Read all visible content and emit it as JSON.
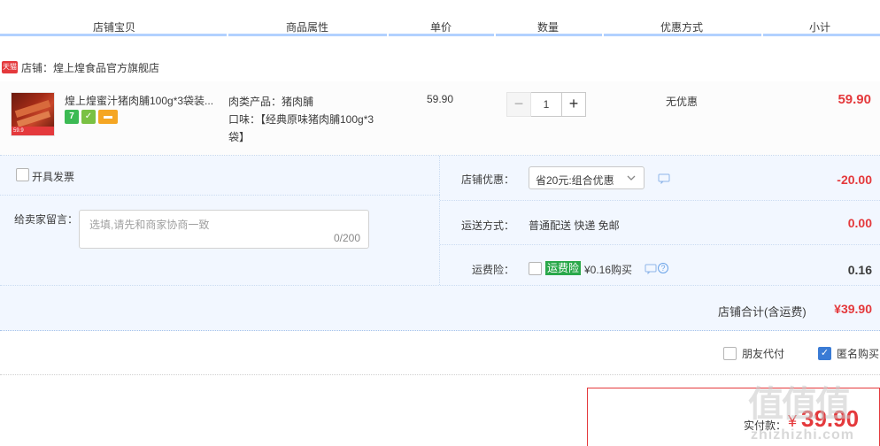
{
  "header": {
    "columns": [
      "店铺宝贝",
      "商品属性",
      "单价",
      "数量",
      "优惠方式",
      "小计"
    ]
  },
  "shop": {
    "badge": "天猫",
    "label": "店铺：煌上煌食品官方旗舰店"
  },
  "item": {
    "thumb_tag": "59.9",
    "title": "煌上煌蜜汁猪肉脯100g*3袋装...",
    "badges": [
      "7",
      "✓",
      "▬"
    ],
    "attr1": "肉类产品：猪肉脯",
    "attr2_line1": "口味：【经典原味猪肉脯100g*3",
    "attr2_line2": "袋】",
    "price": "59.90",
    "quantity": "1",
    "minus": "−",
    "plus": "+",
    "promo": "无优惠",
    "subtotal": "59.90"
  },
  "details": {
    "invoice_label": "开具发票",
    "message_label": "给卖家留言：",
    "message_placeholder": "选填,请先和商家协商一致",
    "message_counter": "0/200",
    "shop_discount_label": "店铺优惠：",
    "shop_discount_value": "省20元:组合优惠",
    "shop_discount_amount": "-20.00",
    "shipping_label": "运送方式：",
    "shipping_value": "普通配送 快递 免邮",
    "shipping_amount": "0.00",
    "insurance_label": "运费险：",
    "insurance_tag": "运费险",
    "insurance_price": "¥0.16购买",
    "insurance_amount": "0.16",
    "total_label": "店铺合计(含运费)",
    "total_value": "¥39.90"
  },
  "options": {
    "friend_pay": "朋友代付",
    "anonymous": "匿名购买"
  },
  "pay": {
    "label": "实付款：",
    "yen": "¥",
    "value": "39.90"
  },
  "watermark": {
    "main": "值值值",
    "sub": "zhizhizhi.com"
  },
  "colors": {
    "accent_red": "#e4393c",
    "header_line": "#b2d1ff",
    "panel_bg": "#f2f7ff",
    "insurance_green": "#2aa84a",
    "check_blue": "#3a7bd5"
  }
}
